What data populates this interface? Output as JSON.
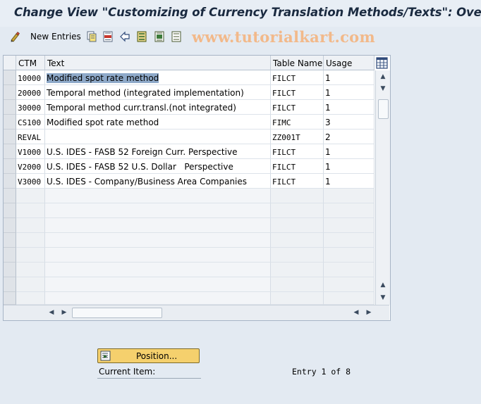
{
  "window": {
    "title": "Change View \"Customizing of Currency Translation Methods/Texts\": Overv"
  },
  "toolbar": {
    "new_entries_label": "New Entries",
    "icons": [
      "edit-glasses-icon",
      "copy-icon",
      "delete-icon",
      "undo-icon",
      "select-all-icon",
      "select-block-icon",
      "deselect-all-icon"
    ]
  },
  "watermark": "www.tutorialkart.com",
  "table": {
    "columns": [
      "CTM",
      "Text",
      "Table Name",
      "Usage"
    ],
    "rows": [
      {
        "ctm": "10000",
        "text": "Modified spot rate method",
        "table": "FILCT",
        "usage": "1"
      },
      {
        "ctm": "20000",
        "text": "Temporal method (integrated implementation)",
        "table": "FILCT",
        "usage": "1"
      },
      {
        "ctm": "30000",
        "text": "Temporal method curr.transl.(not integrated)",
        "table": "FILCT",
        "usage": "1"
      },
      {
        "ctm": "CS100",
        "text": "Modified spot rate method",
        "table": "FIMC",
        "usage": "3"
      },
      {
        "ctm": "REVAL",
        "text": "",
        "table": "ZZ001T",
        "usage": "2"
      },
      {
        "ctm": "V1000",
        "text": "U.S. IDES - FASB 52 Foreign Curr. Perspective",
        "table": "FILCT",
        "usage": "1"
      },
      {
        "ctm": "V2000",
        "text": "U.S. IDES - FASB 52 U.S. Dollar   Perspective",
        "table": "FILCT",
        "usage": "1"
      },
      {
        "ctm": "V3000",
        "text": "U.S. IDES - Company/Business Area Companies",
        "table": "FILCT",
        "usage": "1"
      }
    ],
    "empty_rows": 8,
    "selected_row": 0
  },
  "position_button_label": "Position...",
  "current_item_label": "Current Item:",
  "entry_info": "Entry 1 of 8"
}
